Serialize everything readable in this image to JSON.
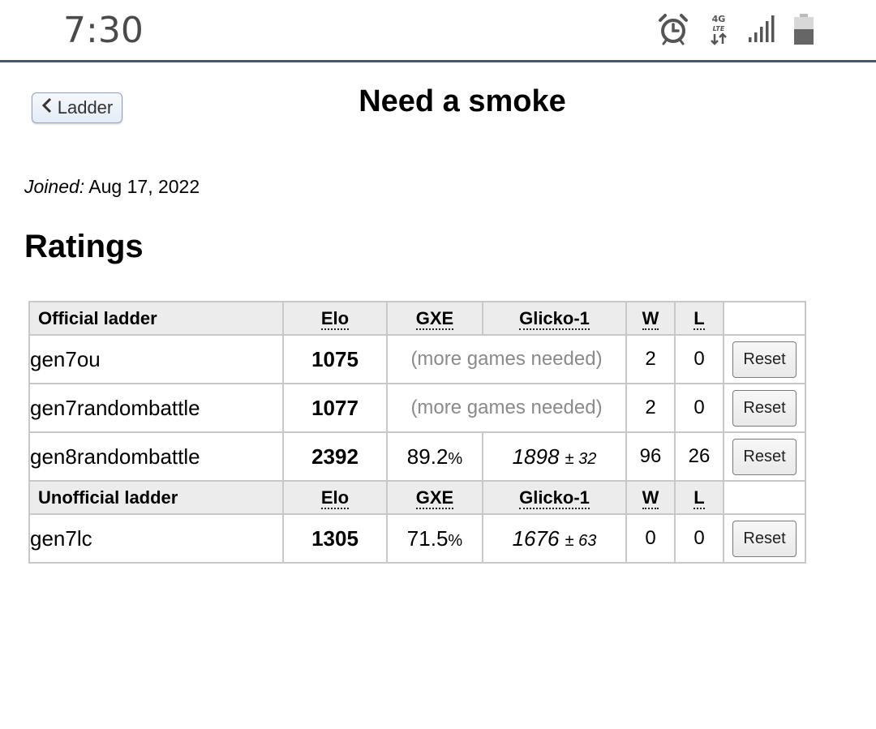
{
  "status_bar": {
    "time": "7:30",
    "icons": [
      "alarm-icon",
      "4g-lte-icon",
      "signal-icon",
      "battery-icon"
    ],
    "network_label_top": "4G",
    "network_label_bottom": "LTE"
  },
  "header": {
    "back_label": "Ladder",
    "title": "Need a smoke"
  },
  "profile": {
    "joined_label": "Joined:",
    "joined_date": "Aug 17, 2022"
  },
  "ratings": {
    "heading": "Ratings",
    "official_header": {
      "ladder": "Official ladder",
      "elo": "Elo",
      "gxe": "GXE",
      "glicko": "Glicko-1",
      "w": "W",
      "l": "L"
    },
    "official_rows": [
      {
        "format": "gen7ou",
        "elo": "1075",
        "needed": "(more games needed)",
        "w": "2",
        "l": "0",
        "action": "Reset"
      },
      {
        "format": "gen7randombattle",
        "elo": "1077",
        "needed": "(more games needed)",
        "w": "2",
        "l": "0",
        "action": "Reset"
      },
      {
        "format": "gen8randombattle",
        "elo": "2392",
        "gxe": "89.2",
        "gxe_unit": "%",
        "glicko": "1898",
        "glicko_dev": "± 32",
        "w": "96",
        "l": "26",
        "action": "Reset"
      }
    ],
    "unofficial_header": {
      "ladder": "Unofficial ladder",
      "elo": "Elo",
      "gxe": "GXE",
      "glicko": "Glicko-1",
      "w": "W",
      "l": "L"
    },
    "unofficial_rows": [
      {
        "format": "gen7lc",
        "elo": "1305",
        "gxe": "71.5",
        "gxe_unit": "%",
        "glicko": "1676",
        "glicko_dev": "± 63",
        "w": "0",
        "l": "0",
        "action": "Reset"
      }
    ]
  },
  "colors": {
    "status_divider": "#46546c",
    "table_border": "#c8c8c8",
    "header_bg": "#ececec",
    "muted_text": "#8a8a8a"
  }
}
